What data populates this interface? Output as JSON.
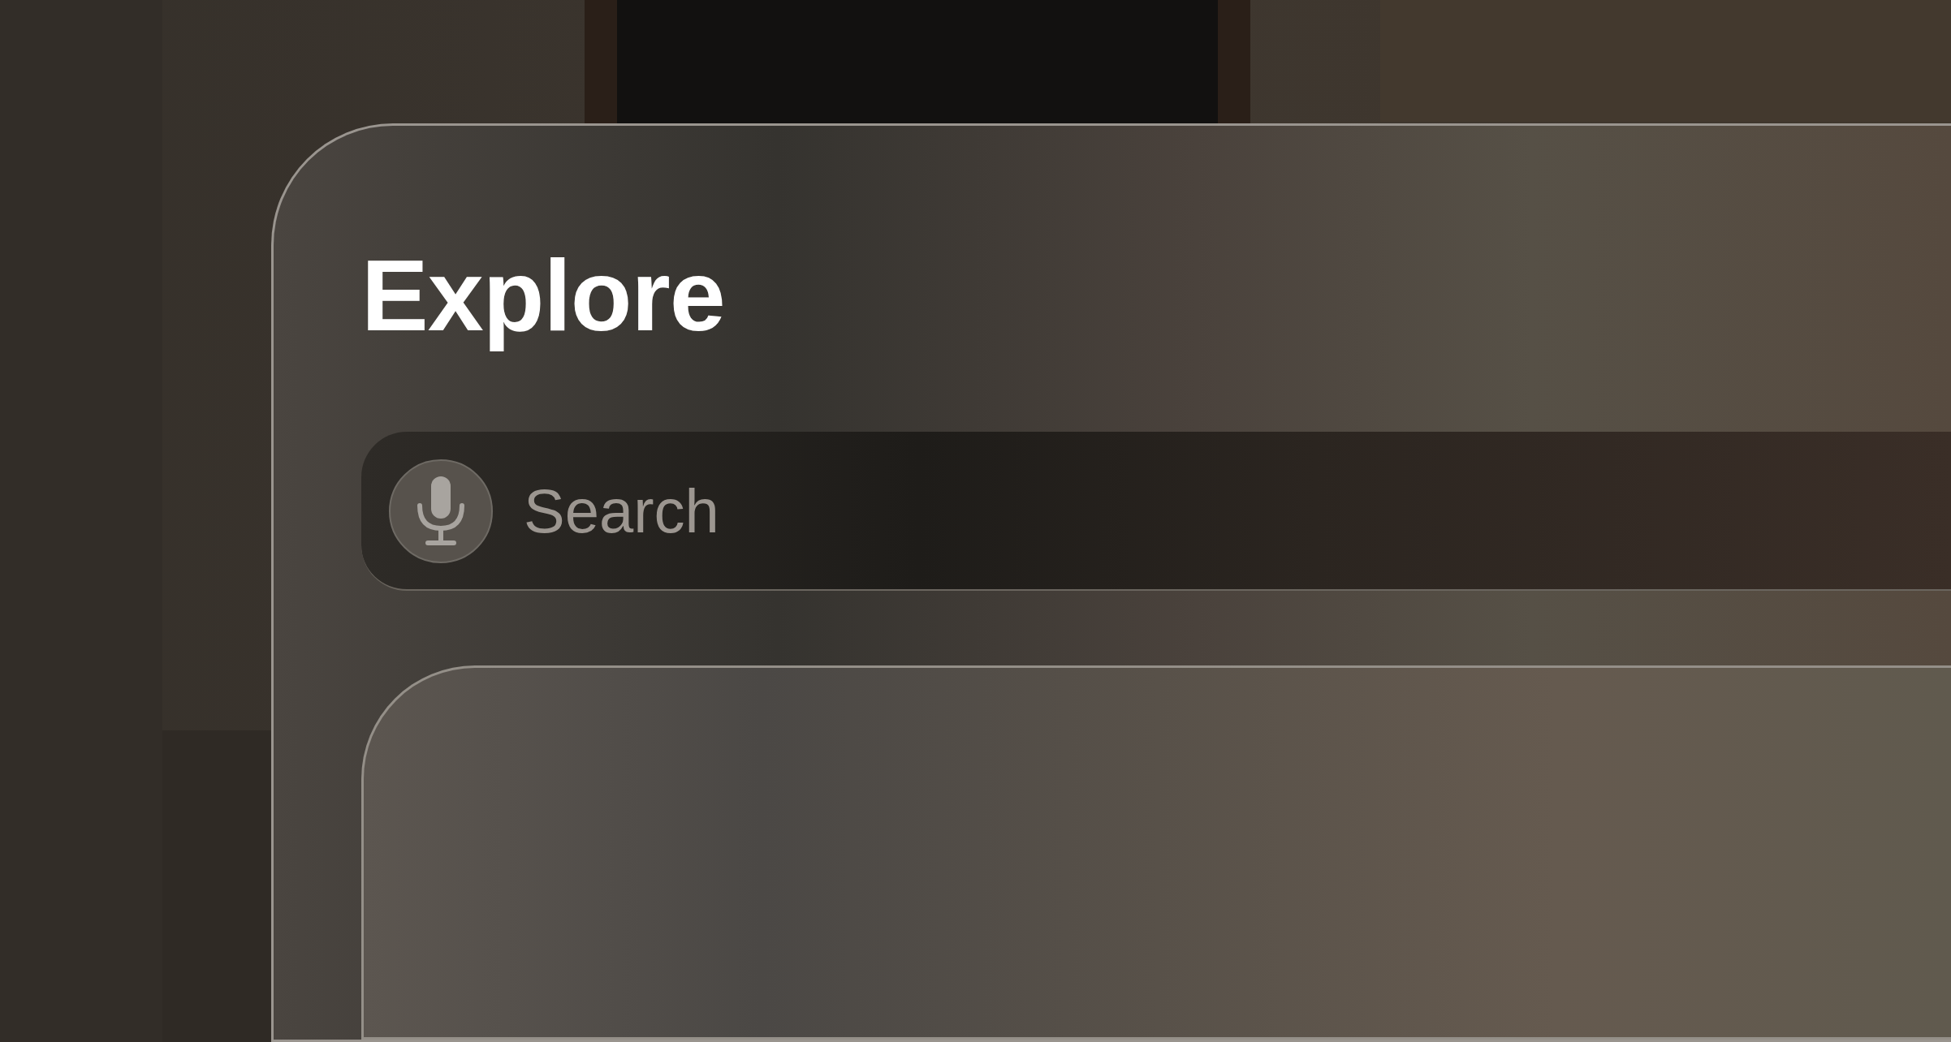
{
  "window": {
    "title": "Explore"
  },
  "search": {
    "placeholder": "Search"
  }
}
